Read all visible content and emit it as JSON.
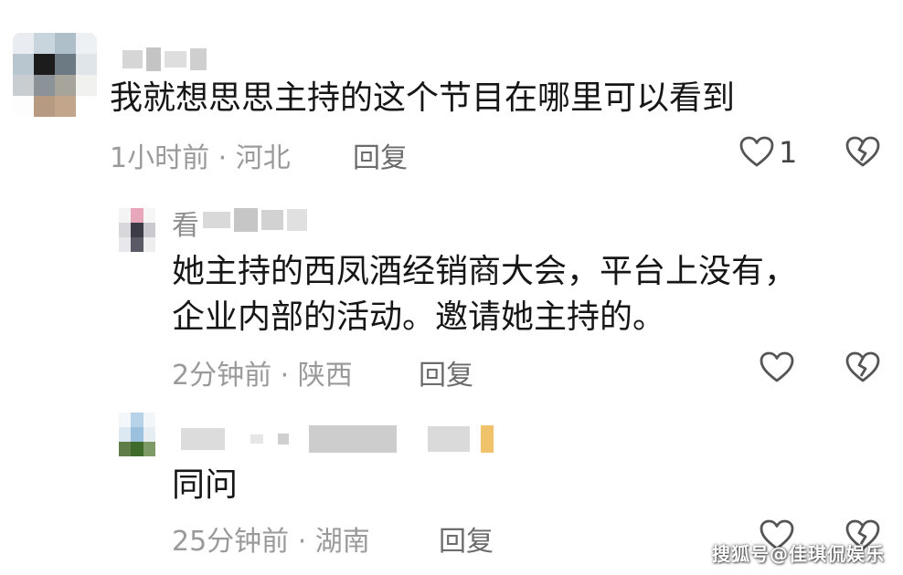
{
  "comments": [
    {
      "text": "我就想思思主持的这个节目在哪里可以看到",
      "meta": "1小时前 · 河北",
      "reply_label": "回复",
      "like_count": "1"
    },
    {
      "name_prefix": "看",
      "text_lines": [
        "她主持的西凤酒经销商大会，平台上没有，",
        "企业内部的活动。邀请她主持的。"
      ],
      "meta": "2分钟前 · 陕西",
      "reply_label": "回复"
    },
    {
      "text": "同问",
      "meta": "25分钟前 · 湖南",
      "reply_label": "回复"
    }
  ],
  "icons": {
    "like": "heart-outline-icon",
    "dislike": "broken-heart-icon"
  },
  "watermark": "搜狐号@佳琪侃娱乐",
  "colors": {
    "text": "#161616",
    "meta": "#9a9a9a",
    "icon": "#555555"
  }
}
